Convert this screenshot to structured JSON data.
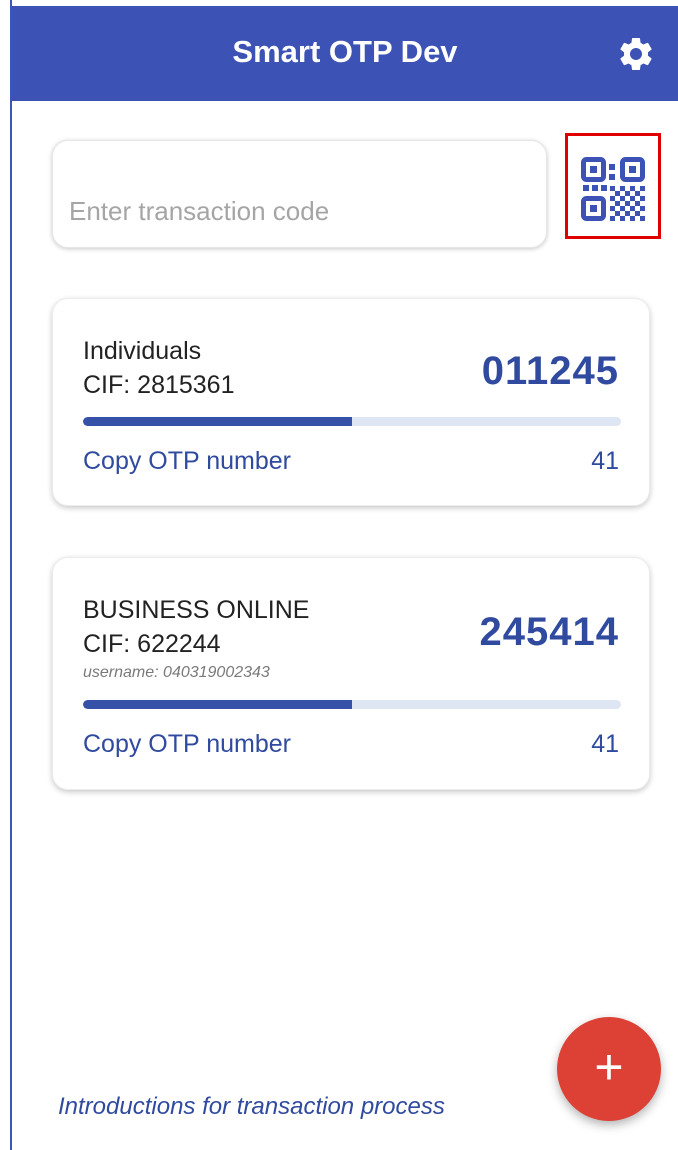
{
  "header": {
    "title": "Smart OTP Dev",
    "settings_icon": "gear-icon"
  },
  "transaction": {
    "placeholder": "Enter transaction code",
    "value": "",
    "scan_icon": "qr-code-icon"
  },
  "accounts": [
    {
      "name": "Individuals",
      "cif": "CIF: 2815361",
      "username": "",
      "otp": "011245",
      "progress": 0.5,
      "copy_label": "Copy OTP number",
      "countdown": "41"
    },
    {
      "name": "BUSINESS ONLINE",
      "cif": "CIF: 622244",
      "username": "username: 040319002343",
      "otp": "245414",
      "progress": 0.5,
      "copy_label": "Copy OTP number",
      "countdown": "41"
    }
  ],
  "footer": {
    "intro_link": "Introductions for transaction process",
    "add_label": "+"
  },
  "colors": {
    "primary": "#3c52b5",
    "otp_text": "#2f4a9e",
    "fab": "#dd4035",
    "highlight_border": "#e00000"
  }
}
